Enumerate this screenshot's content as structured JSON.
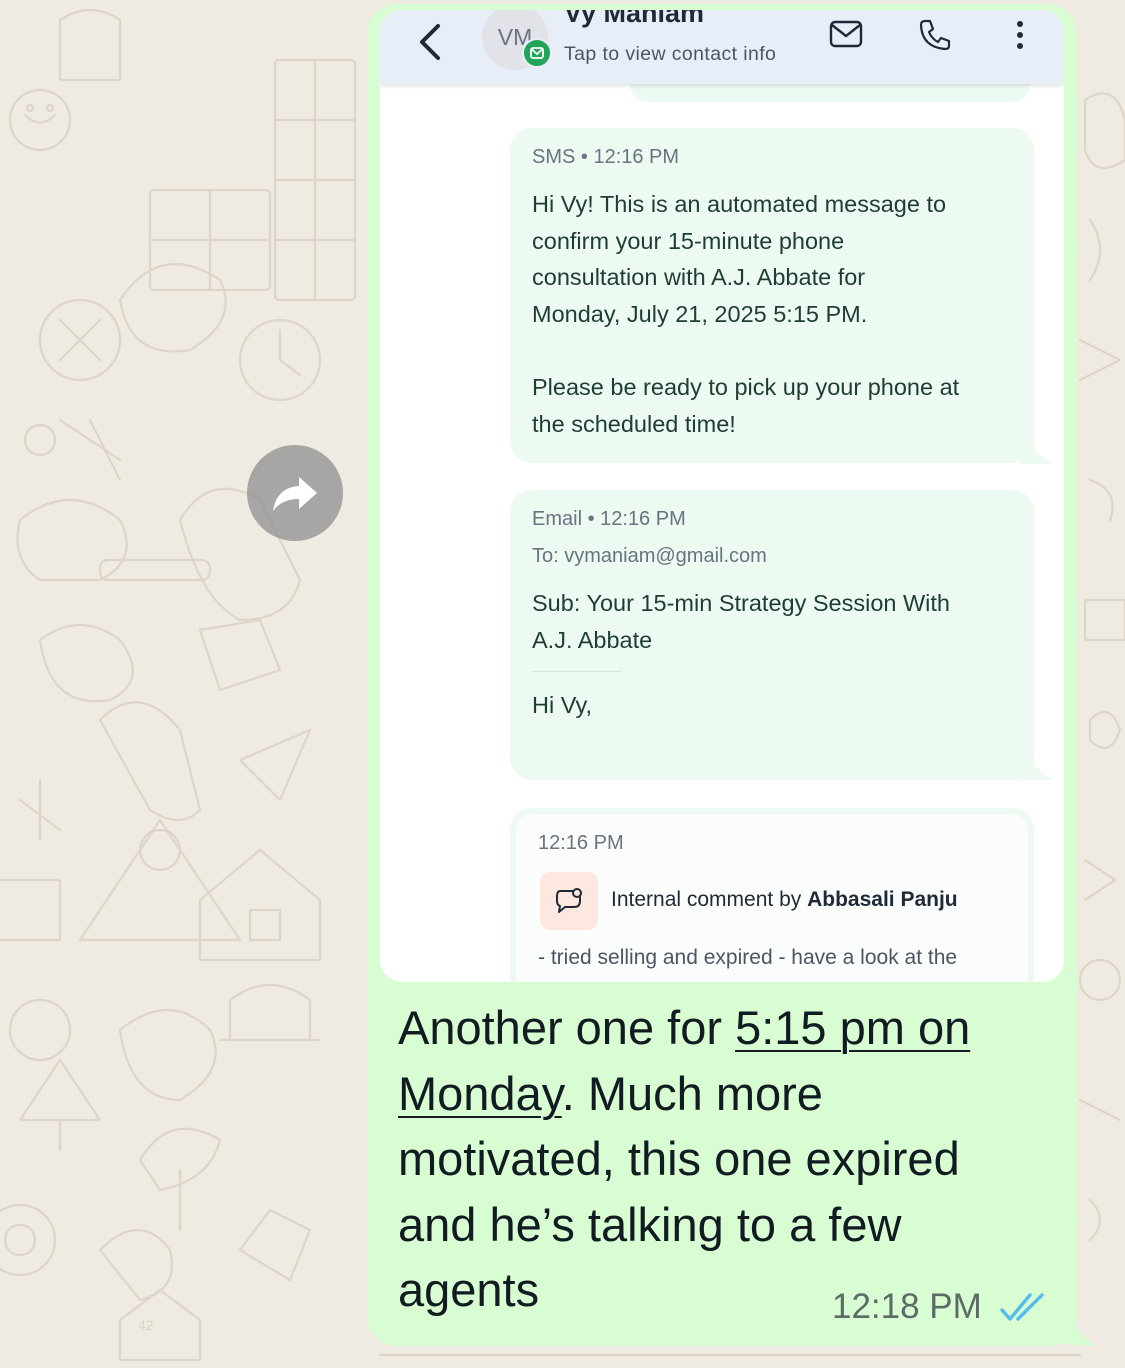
{
  "contact": {
    "initials": "VM",
    "name": "Vy Maniam",
    "subtitle": "Tap to view contact info"
  },
  "icons": {
    "back": "chevron-left-icon",
    "mail": "mail-icon",
    "phone": "phone-icon",
    "more": "more-vertical-icon",
    "forward": "forward-icon",
    "comment": "comment-icon",
    "read": "double-check-icon"
  },
  "sms": {
    "meta": "SMS • 12:16 PM",
    "lines_p1": [
      "Hi Vy! This is an automated message to",
      "confirm your 15-minute phone",
      "consultation with A.J. Abbate for",
      "Monday, July 21, 2025 5:15 PM."
    ],
    "lines_p2": [
      "Please be ready to pick up your phone at",
      "the scheduled time!"
    ]
  },
  "email": {
    "meta": "Email • 12:16 PM",
    "to": "To: vymaniam@gmail.com",
    "subject_lines": [
      "Sub: Your 15-min Strategy Session With",
      "A.J. Abbate"
    ],
    "greeting": "Hi Vy,"
  },
  "comment": {
    "time": "12:16 PM",
    "label_prefix": "Internal comment by ",
    "author": "Abbasali Panju",
    "preview": "- tried selling and expired - have a look at the"
  },
  "message": {
    "prefix": "Another one for ",
    "link": "5:15 pm on Monday",
    "rest": ". Much more motivated, this one expired and he’s talking to a few agents",
    "time": "12:18 PM"
  },
  "colors": {
    "bubble": "#d9fdd3",
    "card": "#ecfaf2",
    "read_ticks": "#53bdeb",
    "badge": "#22a55b"
  }
}
